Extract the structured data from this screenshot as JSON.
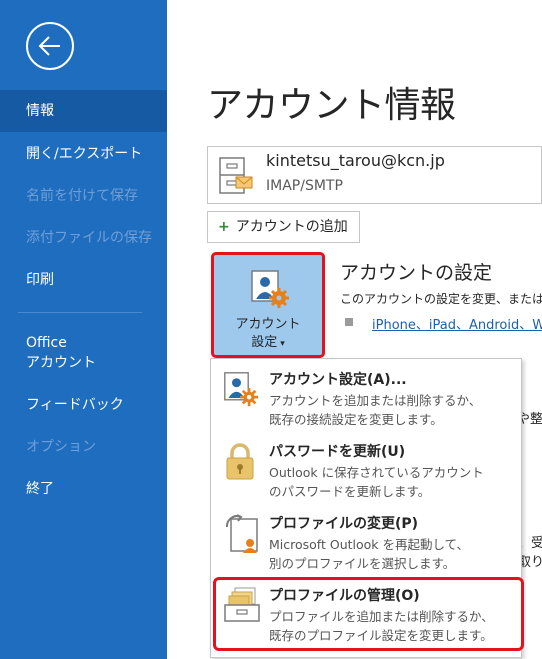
{
  "sidebar": {
    "items": [
      {
        "label": "情報",
        "state": "active"
      },
      {
        "label": "開く/エクスポート",
        "state": "normal"
      },
      {
        "label": "名前を付けて保存",
        "state": "disabled"
      },
      {
        "label": "添付ファイルの保存",
        "state": "disabled"
      },
      {
        "label": "印刷",
        "state": "normal"
      },
      {
        "label": "Office",
        "label2": "アカウント",
        "state": "normal"
      },
      {
        "label": "フィードバック",
        "state": "normal"
      },
      {
        "label": "オプション",
        "state": "disabled"
      },
      {
        "label": "終了",
        "state": "normal"
      }
    ],
    "colors": {
      "bg": "#1f6dbf",
      "active": "#155aa3",
      "disabled": "#6f9fd6"
    }
  },
  "main": {
    "title": "アカウント情報",
    "account": {
      "email": "kintetsu_tarou@kcn.jp",
      "type": "IMAP/SMTP"
    },
    "add_account_label": "アカウントの追加",
    "settings_button": {
      "line1": "アカウント",
      "line2": "設定"
    },
    "section": {
      "title": "アカウントの設定",
      "desc": "このアカウントの設定を変更、または",
      "link": "iPhone、iPad、Android、W"
    },
    "bg_fragments": [
      "や整",
      "、受",
      "取り"
    ]
  },
  "dropdown": {
    "items": [
      {
        "title": "アカウント設定(A)...",
        "desc1": "アカウントを追加または削除するか、",
        "desc2": "既存の接続設定を変更します。",
        "icon": "account-settings-icon"
      },
      {
        "title": "パスワードを更新(U)",
        "desc1": "Outlook に保存されているアカウント",
        "desc2": "のパスワードを更新します。",
        "icon": "lock-icon"
      },
      {
        "title": "プロファイルの変更(P)",
        "desc1": "Microsoft Outlook を再起動して、",
        "desc2": "別のプロファイルを選択します。",
        "icon": "change-profile-icon"
      },
      {
        "title": "プロファイルの管理(O)",
        "desc1": "プロファイルを追加または削除するか、",
        "desc2": "既存のプロファイル設定を変更します。",
        "icon": "manage-profiles-icon"
      }
    ],
    "highlight_color": "#e3121f"
  }
}
